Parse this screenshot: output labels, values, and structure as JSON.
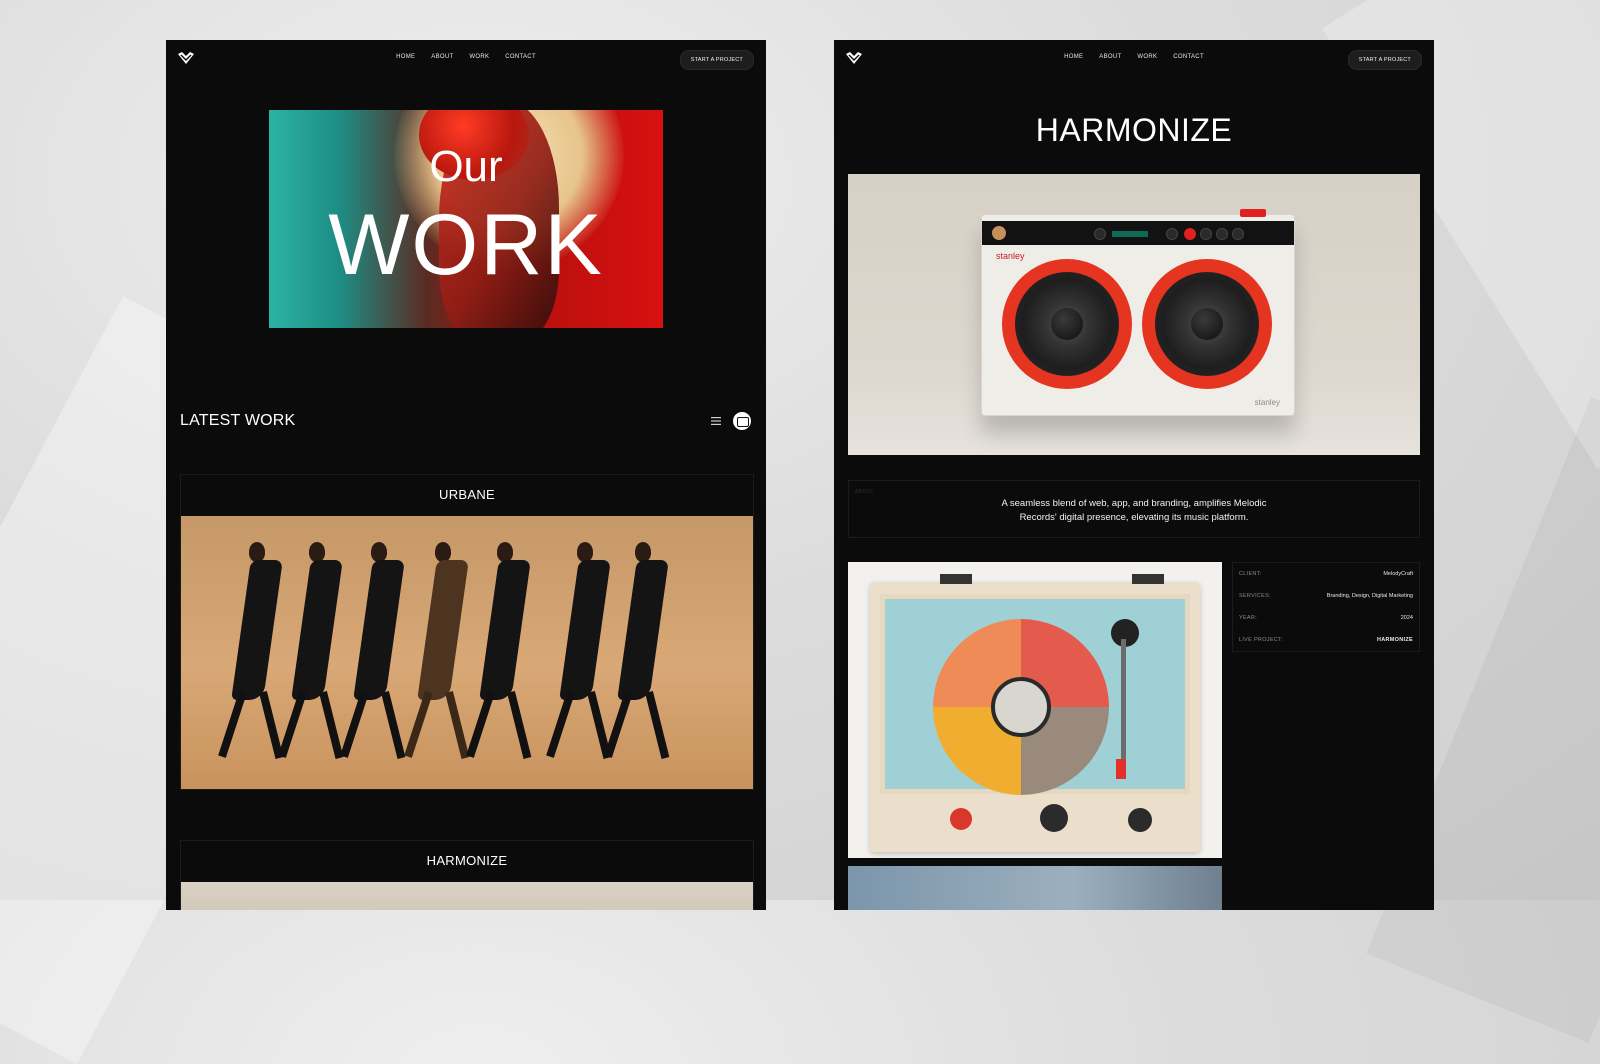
{
  "left_page": {
    "nav": {
      "links": [
        "HOME",
        "ABOUT",
        "WORK",
        "CONTACT"
      ],
      "cta": "START A PROJECT"
    },
    "hero": {
      "line1": "Our",
      "line2": "WORK"
    },
    "section_title": "LATEST WORK",
    "projects": [
      {
        "title": "URBANE"
      },
      {
        "title": "HARMONIZE"
      }
    ]
  },
  "right_page": {
    "nav": {
      "links": [
        "HOME",
        "ABOUT",
        "WORK",
        "CONTACT"
      ],
      "cta": "START A PROJECT"
    },
    "title": "HARMONIZE",
    "speaker_brand": "stanley",
    "about": {
      "label": "ABOUT",
      "text": "A seamless blend of web, app, and branding, amplifies Melodic Records' digital presence, elevating its music platform."
    },
    "details": [
      {
        "key": "CLIENT:",
        "value": "MelodyCraft"
      },
      {
        "key": "SERVICES:",
        "value": "Branding, Design, Digital Marketing"
      },
      {
        "key": "YEAR:",
        "value": "2024"
      },
      {
        "key": "LIVE PROJECT:",
        "value": "HARMONIZE"
      }
    ]
  },
  "icons": {
    "logo": "heart-check-logo",
    "view_list": "list-view-icon",
    "view_grid": "grid-view-icon"
  },
  "colors": {
    "panel_bg": "#0b0b0b",
    "accent_red": "#e5341f",
    "text": "#ffffff"
  }
}
